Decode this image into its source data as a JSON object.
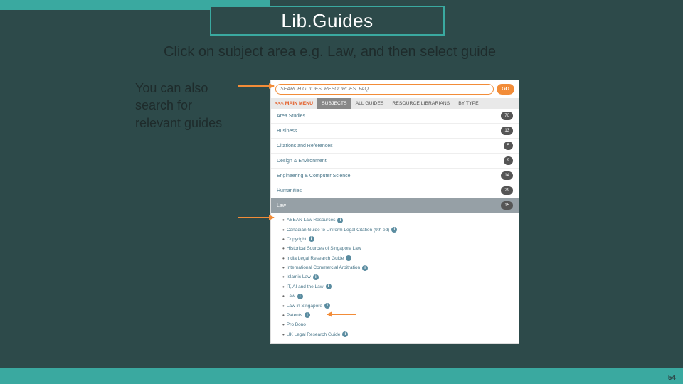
{
  "slide": {
    "title": "Lib.Guides",
    "subtitle": "Click on subject area e.g. Law, and then select guide",
    "left_note": "You can also search for relevant guides",
    "page_number": "54"
  },
  "libguides": {
    "search_placeholder": "SEARCH GUIDES, RESOURCES, FAQ",
    "go_label": "GO",
    "main_menu_label": "<<< MAIN MENU",
    "tabs": [
      {
        "label": "SUBJECTS",
        "active": true
      },
      {
        "label": "ALL GUIDES",
        "active": false
      },
      {
        "label": "RESOURCE LIBRARIANS",
        "active": false
      },
      {
        "label": "BY TYPE",
        "active": false
      }
    ],
    "categories": [
      {
        "name": "Area Studies",
        "count": "70",
        "active": false
      },
      {
        "name": "Business",
        "count": "13",
        "active": false
      },
      {
        "name": "Citations and References",
        "count": "5",
        "active": false
      },
      {
        "name": "Design & Environment",
        "count": "9",
        "active": false
      },
      {
        "name": "Engineering & Computer Science",
        "count": "14",
        "active": false
      },
      {
        "name": "Humanities",
        "count": "29",
        "active": false
      },
      {
        "name": "Law",
        "count": "15",
        "active": true
      }
    ],
    "law_items": [
      {
        "label": "ASEAN Law Resources",
        "info": true
      },
      {
        "label": "Canadian Guide to Uniform Legal Citation (9th ed)",
        "info": true
      },
      {
        "label": "Copyright",
        "info": true
      },
      {
        "label": "Historical Sources of Singapore Law",
        "info": false
      },
      {
        "label": "India Legal Research Guide",
        "info": true
      },
      {
        "label": "International Commercial Arbitration",
        "info": true
      },
      {
        "label": "Islamic Law",
        "info": true
      },
      {
        "label": "IT, AI and the Law",
        "info": true
      },
      {
        "label": "Law",
        "info": true
      },
      {
        "label": "Law in Singapore",
        "info": true
      },
      {
        "label": "Patents",
        "info": true
      },
      {
        "label": "Pro Bono",
        "info": false
      },
      {
        "label": "UK Legal Research Guide",
        "info": true
      }
    ]
  }
}
